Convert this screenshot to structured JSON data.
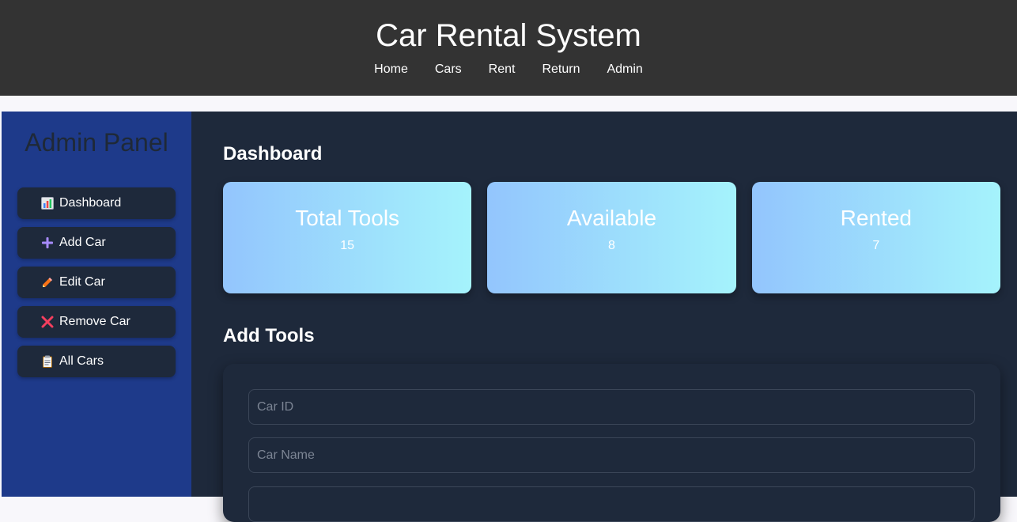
{
  "header": {
    "title": "Car Rental System",
    "nav": [
      "Home",
      "Cars",
      "Rent",
      "Return",
      "Admin"
    ]
  },
  "sidebar": {
    "title": "Admin Panel",
    "items": [
      {
        "label": "Dashboard",
        "icon": "bar-chart-icon"
      },
      {
        "label": "Add Car",
        "icon": "plus-icon"
      },
      {
        "label": "Edit Car",
        "icon": "pencil-icon"
      },
      {
        "label": "Remove Car",
        "icon": "cross-icon"
      },
      {
        "label": "All Cars",
        "icon": "clipboard-icon"
      }
    ]
  },
  "main": {
    "dashboard_title": "Dashboard",
    "stats": [
      {
        "label": "Total Tools",
        "value": "15"
      },
      {
        "label": "Available",
        "value": "8"
      },
      {
        "label": "Rented",
        "value": "7"
      }
    ],
    "form_title": "Add Tools",
    "form": {
      "car_id_placeholder": "Car ID",
      "car_name_placeholder": "Car Name"
    }
  },
  "colors": {
    "header_bg": "#333333",
    "sidebar_bg": "#1e3a8a",
    "main_bg": "#1e293b",
    "card_gradient_start": "#93c5fd",
    "card_gradient_end": "#a5f3fc"
  }
}
